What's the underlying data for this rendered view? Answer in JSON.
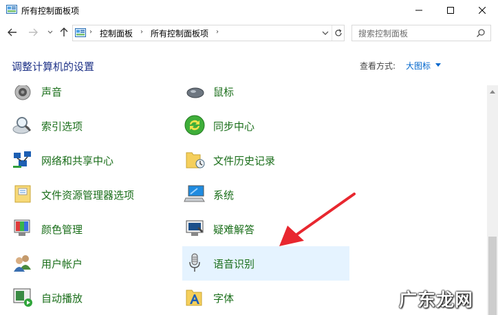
{
  "window": {
    "title": "所有控制面板项"
  },
  "nav": {
    "breadcrumbs": [
      "控制面板",
      "所有控制面板项"
    ],
    "search_placeholder": "搜索控制面板"
  },
  "header": {
    "heading": "调整计算机的设置",
    "view_by_label": "查看方式:",
    "view_by_value": "大图标"
  },
  "left_items": [
    {
      "label": "声音",
      "icon": "speaker-icon"
    },
    {
      "label": "索引选项",
      "icon": "indexing-magnifier-icon"
    },
    {
      "label": "网络和共享中心",
      "icon": "network-icon"
    },
    {
      "label": "文件资源管理器选项",
      "icon": "folder-options-icon"
    },
    {
      "label": "颜色管理",
      "icon": "color-management-icon"
    },
    {
      "label": "用户帐户",
      "icon": "user-accounts-icon"
    },
    {
      "label": "自动播放",
      "icon": "autoplay-icon"
    }
  ],
  "right_items": [
    {
      "label": "鼠标",
      "icon": "mouse-icon"
    },
    {
      "label": "同步中心",
      "icon": "sync-center-icon"
    },
    {
      "label": "文件历史记录",
      "icon": "file-history-icon"
    },
    {
      "label": "系统",
      "icon": "system-icon"
    },
    {
      "label": "疑难解答",
      "icon": "troubleshooting-icon"
    },
    {
      "label": "语音识别",
      "icon": "microphone-icon",
      "selected": true
    },
    {
      "label": "字体",
      "icon": "fonts-icon"
    }
  ],
  "watermark": "广东龙网",
  "colors": {
    "accent": "#0066cc",
    "label_green": "#1a6e1a",
    "selection": "#e5f3ff",
    "arrow": "#e8272f"
  }
}
